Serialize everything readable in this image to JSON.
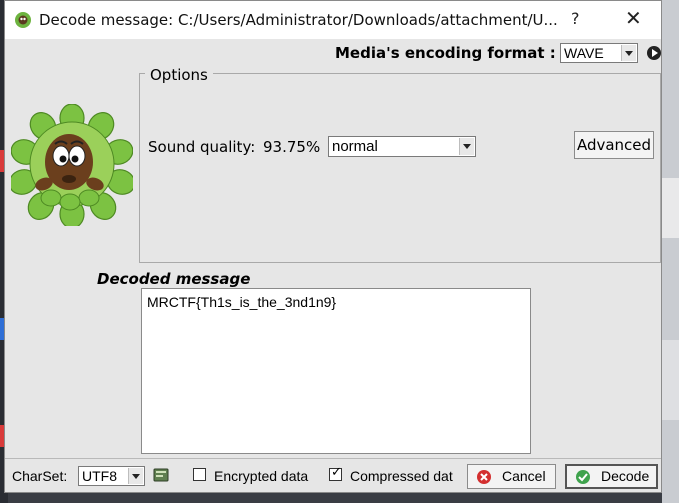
{
  "window": {
    "title": "Decode message: C:/Users/Administrator/Downloads/attachment/U...",
    "help_label": "?",
    "close_label": "✕"
  },
  "encoding": {
    "label": "Media's encoding format :",
    "selected": "WAVE"
  },
  "options": {
    "legend": "Options",
    "sound_quality_label": "Sound quality:",
    "sound_quality_value": "93.75%",
    "quality_selected": "normal",
    "advanced_label": "Advanced"
  },
  "decoded": {
    "label": "Decoded message",
    "text": "MRCTF{Th1s_is_the_3nd1n9}"
  },
  "footer": {
    "charset_label": "CharSet:",
    "charset_value": "UTF8",
    "encrypted_label": "Encrypted data",
    "encrypted_checked": false,
    "compressed_label": "Compressed dat",
    "compressed_checked": true,
    "cancel_label": "Cancel",
    "decode_label": "Decode"
  },
  "icons": {
    "app": "app-leaf-icon",
    "avatar": "character-avatar",
    "cancel": "cancel-icon",
    "decode": "decode-check-icon",
    "charset": "charset-book-icon",
    "play": "play-icon"
  },
  "colors": {
    "cancel_icon": "#d32f2f",
    "decode_icon": "#3fa34d",
    "window_bg": "#e6e6e6"
  }
}
